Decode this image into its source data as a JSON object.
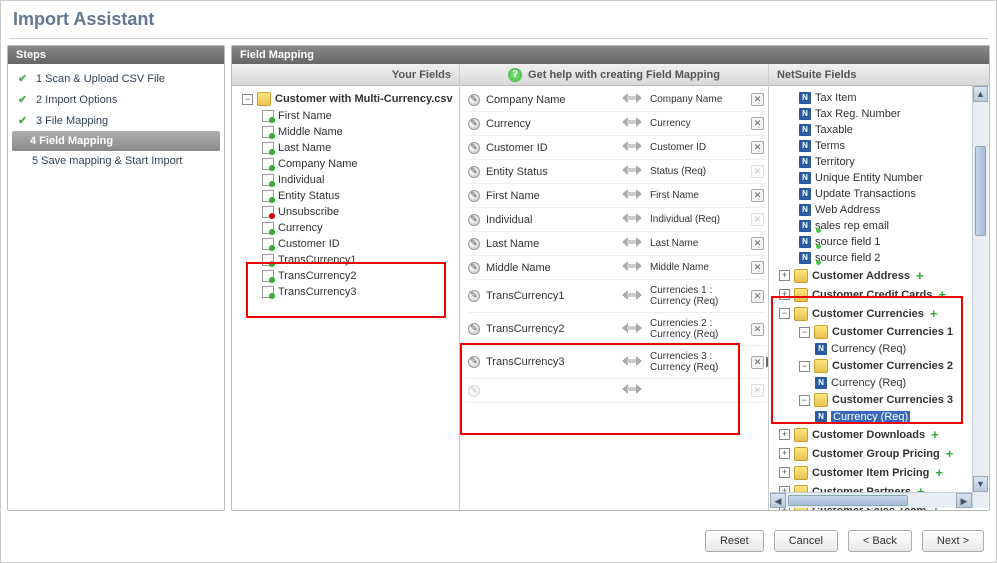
{
  "title": "Import Assistant",
  "steps_header": "Steps",
  "steps": [
    {
      "num": "1",
      "label": "Scan & Upload CSV File",
      "done": true
    },
    {
      "num": "2",
      "label": "Import Options",
      "done": true
    },
    {
      "num": "3",
      "label": "File Mapping",
      "done": true
    },
    {
      "num": "4",
      "label": "Field Mapping",
      "active": true
    },
    {
      "num": "5",
      "label": "Save mapping & Start Import",
      "done": false
    }
  ],
  "mapping_header": "Field Mapping",
  "your_fields_header": "Your Fields",
  "center_header": "Get help with creating Field Mapping",
  "ns_fields_header": "NetSuite Fields",
  "csv_file_name": "Customer with Multi-Currency.csv",
  "csv_fields": [
    "First Name",
    "Middle Name",
    "Last Name",
    "Company Name",
    "Individual",
    "Entity Status",
    "Unsubscribe",
    "Currency",
    "Customer ID",
    "TransCurrency1",
    "TransCurrency2",
    "TransCurrency3"
  ],
  "mappings": [
    {
      "left": "Company Name",
      "right": "Company Name",
      "removable": true
    },
    {
      "left": "Currency",
      "right": "Currency",
      "removable": true
    },
    {
      "left": "Customer ID",
      "right": "Customer ID",
      "removable": true
    },
    {
      "left": "Entity Status",
      "right": "Status (Req)",
      "removable": false
    },
    {
      "left": "First Name",
      "right": "First Name",
      "removable": true
    },
    {
      "left": "Individual",
      "right": "Individual (Req)",
      "removable": false
    },
    {
      "left": "Last Name",
      "right": "Last Name",
      "removable": true
    },
    {
      "left": "Middle Name",
      "right": "Middle Name",
      "removable": true
    },
    {
      "left": "TransCurrency1",
      "right": "Currencies 1 : Currency (Req)",
      "removable": true,
      "hl": true
    },
    {
      "left": "TransCurrency2",
      "right": "Currencies 2 : Currency (Req)",
      "removable": true,
      "hl": true
    },
    {
      "left": "TransCurrency3",
      "right": "Currencies 3 : Currency (Req)",
      "removable": true,
      "hl": true,
      "tri": true
    }
  ],
  "ns_simple_fields": [
    "Tax Item",
    "Tax Reg. Number",
    "Taxable",
    "Terms",
    "Territory",
    "Unique Entity Number",
    "Update Transactions",
    "Web Address"
  ],
  "ns_green_fields": [
    "sales rep email",
    "source field 1",
    "source field 2"
  ],
  "ns_folders_top": [
    "Customer Address",
    "Customer Credit Cards"
  ],
  "ns_currencies": {
    "root": "Customer Currencies",
    "subs": [
      {
        "name": "Customer Currencies 1",
        "child": "Currency (Req)"
      },
      {
        "name": "Customer Currencies 2",
        "child": "Currency (Req)"
      },
      {
        "name": "Customer Currencies 3",
        "child": "Currency (Req)",
        "sel": true
      }
    ]
  },
  "ns_folders_bottom": [
    "Customer Downloads",
    "Customer Group Pricing",
    "Customer Item Pricing",
    "Customer Partners",
    "Customer Sales Team"
  ],
  "buttons": {
    "reset": "Reset",
    "cancel": "Cancel",
    "back": "< Back",
    "next": "Next >"
  }
}
